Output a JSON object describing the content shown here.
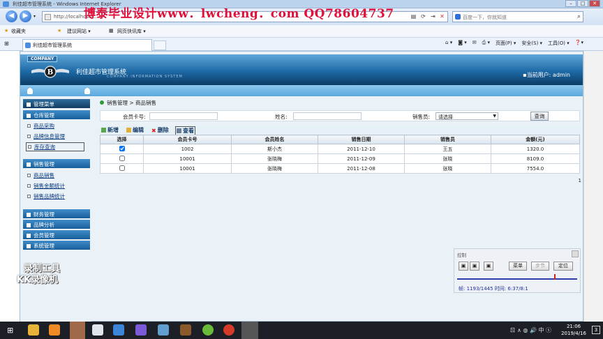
{
  "browser": {
    "window_title": "利佳超市管理系统 - Windows Internet Explorer",
    "address": "http://localhost/...",
    "search_placeholder": "百度一下，你就知道",
    "watermark": "博泰毕业设计www．lwcheng．com QQ78604737",
    "favorites": [
      "收藏夹",
      "建议网站 ▾",
      "网页快讯库 ▾"
    ],
    "tab_title": "利佳超市管理系统",
    "commands": [
      "页面(P) ▾",
      "安全(S) ▾",
      "工具(O) ▾",
      "❓▾"
    ]
  },
  "app": {
    "company_tag": "COMPANY",
    "system_name": "利佳超市管理系统",
    "system_subtitle": "COMPANY INFORMATION SYSTEM",
    "current_user": "▪当前用户: admin"
  },
  "sidebar": {
    "title": "管理菜单",
    "groups": [
      {
        "label": "仓库管理",
        "items": [
          "商品采购",
          "品牌信息管理",
          "库存查询"
        ]
      },
      {
        "label": "销售管理",
        "items": [
          "商品销售",
          "销售金额统计",
          "销售品牌统计"
        ]
      },
      {
        "label": "财务管理"
      },
      {
        "label": "品牌分析"
      },
      {
        "label": "会员管理"
      },
      {
        "label": "系统管理"
      }
    ]
  },
  "main": {
    "breadcrumb": "销售管理 > 商品销售",
    "filter": {
      "member_card_label": "会员卡号:",
      "name_label": "姓名:",
      "seller_label": "销售员:",
      "seller_value": "请选择",
      "query_button": "查询"
    },
    "toolbar": [
      "新增",
      "编辑",
      "删除",
      "查看"
    ],
    "table": {
      "headers": [
        "选择",
        "会员卡号",
        "会员姓名",
        "销售日期",
        "销售员",
        "金额(元)"
      ],
      "rows": [
        {
          "checked": true,
          "card": "1002",
          "name": "斯小杰",
          "date": "2011-12-10",
          "seller": "王五",
          "amount": "1320.0"
        },
        {
          "checked": false,
          "card": "10001",
          "name": "张晓梅",
          "date": "2011-12-09",
          "seller": "张晓",
          "amount": "8109.0"
        },
        {
          "checked": false,
          "card": "10001",
          "name": "张晓梅",
          "date": "2011-12-08",
          "seller": "张晓",
          "amount": "7554.0"
        }
      ]
    },
    "page_number": "1"
  },
  "recorder": {
    "title": "控制",
    "buttons": [
      "菜单",
      "步节",
      "定位"
    ],
    "status": "帧: 1193/1445 时间: 6:37/8:1",
    "progress_fraction": 0.82
  },
  "overlay_text": [
    "录制工具",
    "KK录像机"
  ],
  "taskbar": {
    "tray": "ㄖ ∧ ◍ 🔊 中 ⓢ",
    "time": "21:06",
    "date": "2019/4/16",
    "badge": "3"
  }
}
